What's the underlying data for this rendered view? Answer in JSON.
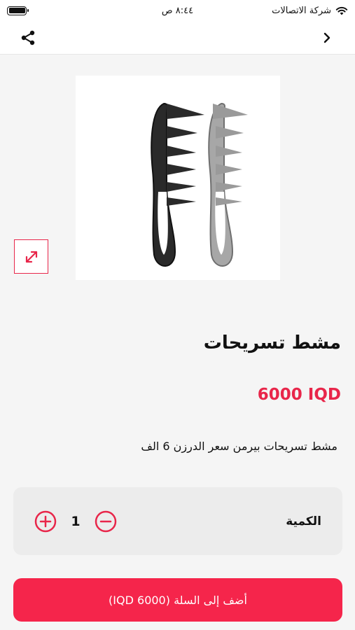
{
  "status_bar": {
    "carrier": "شركة الاتصالات",
    "time": "٨:٤٤ ص",
    "battery_level": 1.0
  },
  "nav": {
    "back_icon": "chevron-right-icon",
    "share_icon": "share-icon"
  },
  "product": {
    "title": "مشط تسريحات",
    "price": "6000 IQD",
    "description": "مشط تسريحات بيرمن سعر الدرزن 6 الف",
    "image_icon": "comb-image",
    "expand_icon": "expand-icon"
  },
  "quantity": {
    "label": "الكمية",
    "value": "1",
    "increment_icon": "plus-circle-icon",
    "decrement_icon": "minus-circle-icon"
  },
  "cart": {
    "add_label": "أضف إلى السلة (IQD 6000)"
  },
  "colors": {
    "accent": "#e8264a",
    "button": "#f5254b",
    "background": "#f5f5f5"
  }
}
